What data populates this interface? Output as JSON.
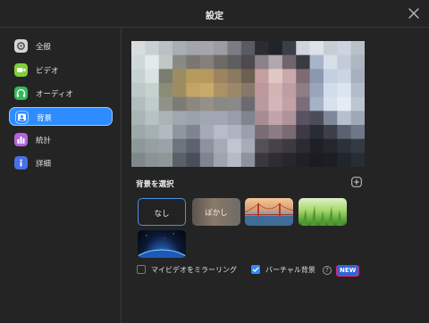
{
  "window": {
    "title": "設定",
    "close_icon": "close-icon"
  },
  "sidebar": {
    "items": [
      {
        "id": "general",
        "label": "全般",
        "icon": "gear-icon",
        "color": "#d5d5d5",
        "active": false
      },
      {
        "id": "video",
        "label": "ビデオ",
        "icon": "video-camera-icon",
        "color": "#7fcf3a",
        "active": false
      },
      {
        "id": "audio",
        "label": "オーディオ",
        "icon": "headphones-icon",
        "color": "#35b95a",
        "active": false
      },
      {
        "id": "background",
        "label": "背景",
        "icon": "background-image-icon",
        "color": "#2d8cff",
        "active": true
      },
      {
        "id": "stats",
        "label": "統計",
        "icon": "bar-chart-icon",
        "color": "#b365d9",
        "active": false
      },
      {
        "id": "details",
        "label": "詳細",
        "icon": "info-icon",
        "color": "#4a6fe8",
        "active": false
      }
    ]
  },
  "background": {
    "section_label": "背景を選択",
    "add_icon": "plus-icon",
    "thumbnails": [
      {
        "id": "none",
        "label": "なし",
        "selected": true
      },
      {
        "id": "blur",
        "label": "ぼかし",
        "selected": false
      },
      {
        "id": "golden-gate",
        "label": "",
        "selected": false
      },
      {
        "id": "grass",
        "label": "",
        "selected": false
      },
      {
        "id": "earth",
        "label": "",
        "selected": false
      }
    ]
  },
  "options": {
    "mirror": {
      "label": "マイビデオをミラーリング",
      "checked": false
    },
    "virtual_bg": {
      "label": "バーチャル背景",
      "checked": true,
      "help": "?",
      "badge": "NEW"
    }
  },
  "colors": {
    "accent": "#2d8cff",
    "window_bg": "#242424",
    "badge_bg": "#2f66d8",
    "badge_border": "#e0236f"
  }
}
